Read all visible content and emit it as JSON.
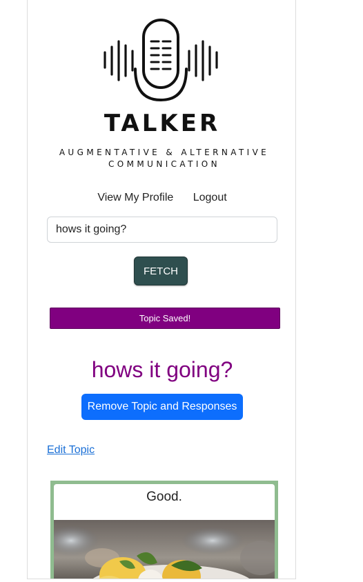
{
  "app": {
    "brand_name": "TALKER",
    "tagline_line1": "AUGMENTATIVE & ALTERNATIVE",
    "tagline_line2": "COMMUNICATION",
    "logo_icon": "microphone-soundwave-icon"
  },
  "nav": {
    "profile_label": "View My Profile",
    "logout_label": "Logout"
  },
  "search": {
    "value": "hows it going?"
  },
  "fetch_label": "FETCH",
  "alert_text": "Topic Saved!",
  "topic": {
    "title": "hows it going?",
    "remove_label": "Remove Topic and Responses",
    "edit_label": "Edit Topic"
  },
  "responses": [
    {
      "text": "Good.",
      "image": "food-photo"
    }
  ],
  "colors": {
    "accent_purple": "#800080",
    "fetch_bg": "#2f4f4f",
    "primary_blue": "#0d6efd",
    "card_border_green": "#8fbc8f"
  }
}
